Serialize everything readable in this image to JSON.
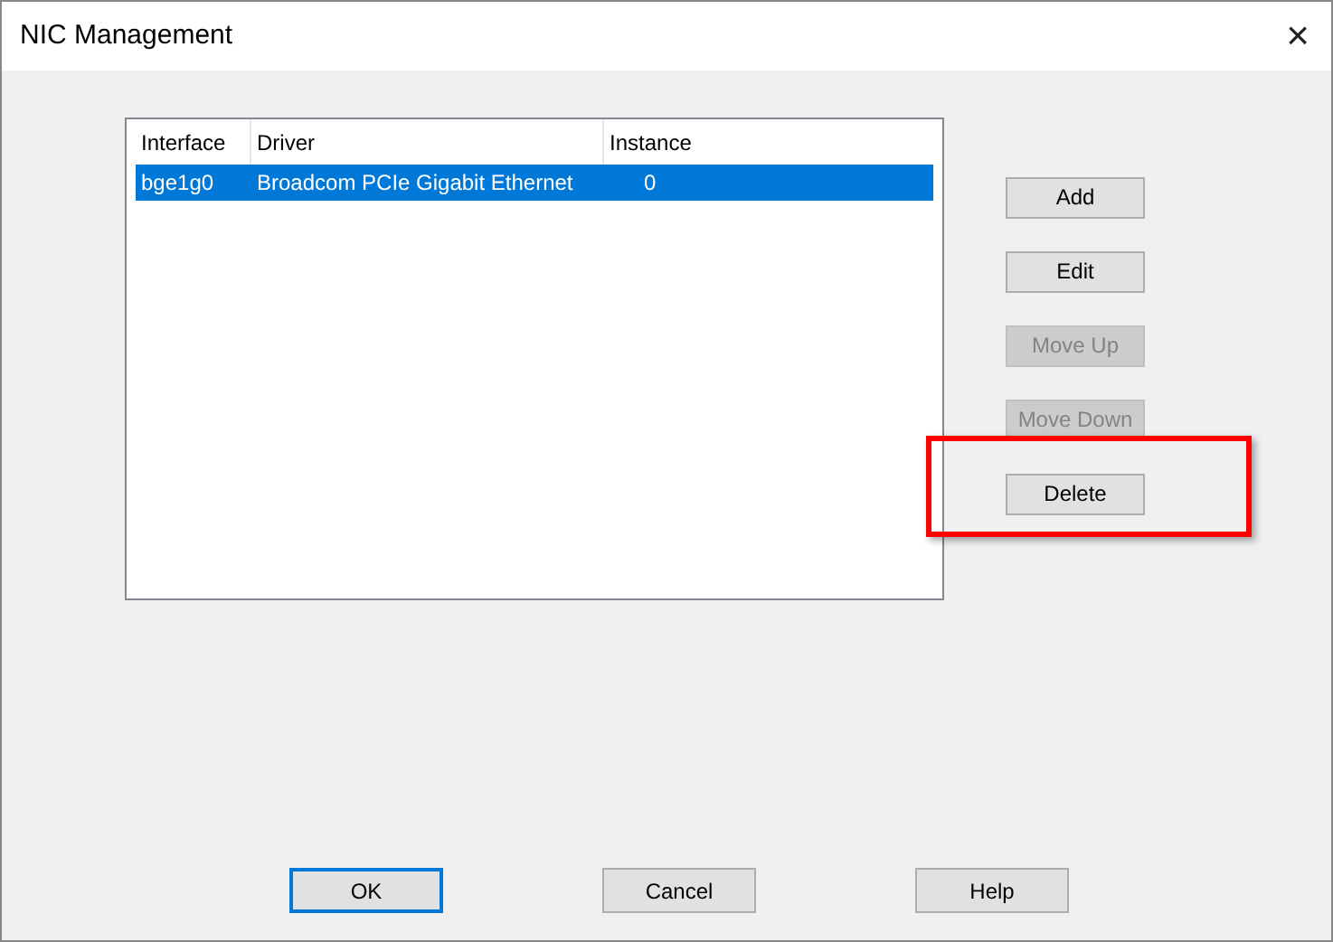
{
  "window": {
    "title": "NIC Management",
    "close": "×"
  },
  "table": {
    "columns": [
      "Interface",
      "Driver",
      "Instance"
    ],
    "rows": [
      {
        "cells": [
          "bge1g0",
          "Broadcom PCIe Gigabit Ethernet",
          "0"
        ],
        "selected": true
      }
    ]
  },
  "side_buttons": [
    {
      "label": "Add",
      "disabled": false,
      "highlighted": false
    },
    {
      "label": "Edit",
      "disabled": false,
      "highlighted": false
    },
    {
      "label": "Move Up",
      "disabled": true,
      "highlighted": false
    },
    {
      "label": "Move Down",
      "disabled": true,
      "highlighted": false
    },
    {
      "label": "Delete",
      "disabled": false,
      "highlighted": true
    }
  ],
  "buttons": [
    {
      "label": "OK",
      "default": true
    },
    {
      "label": "Cancel",
      "default": false
    },
    {
      "label": "Help",
      "default": false
    }
  ]
}
